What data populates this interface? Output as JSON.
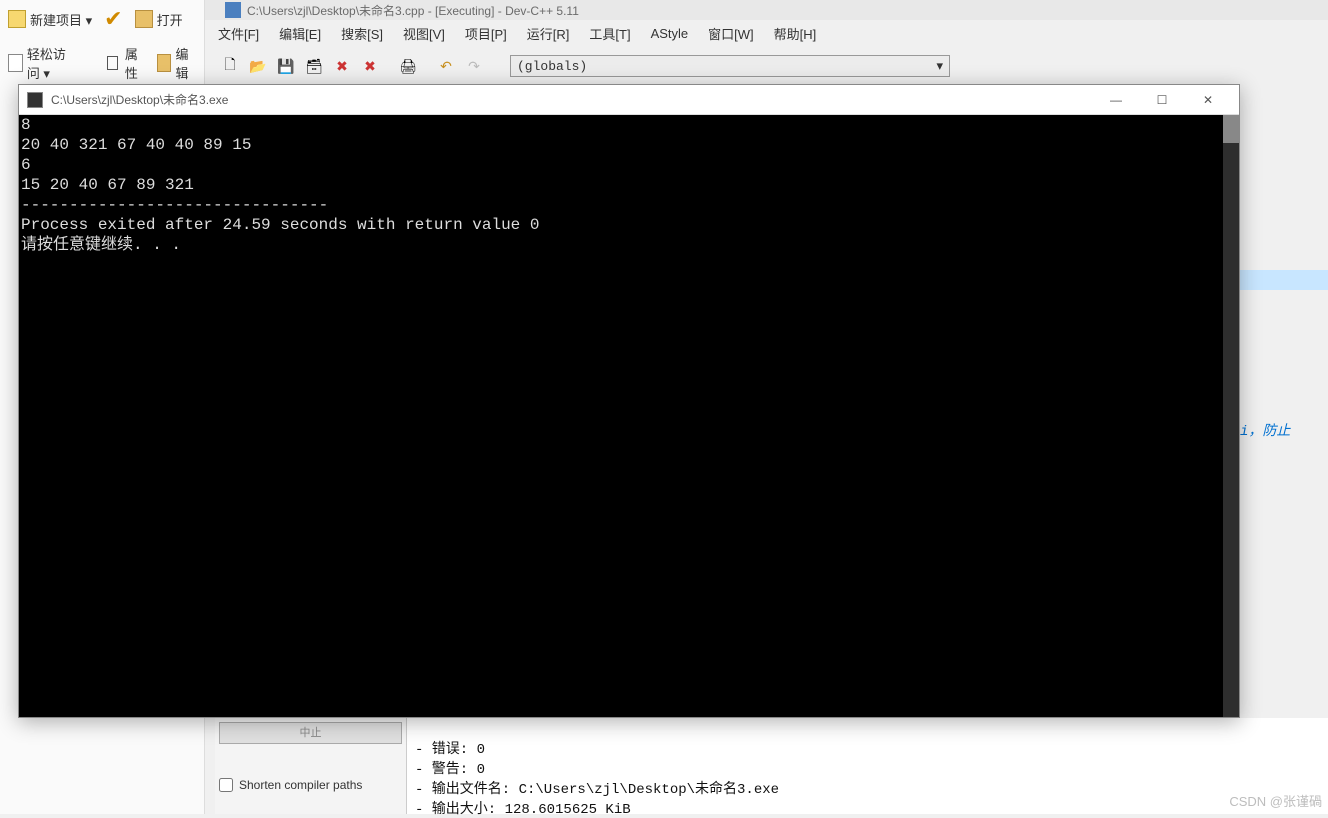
{
  "devcpp": {
    "title": "C:\\Users\\zjl\\Desktop\\未命名3.cpp - [Executing] - Dev-C++ 5.11",
    "ribbon": {
      "new_project": "新建项目 ▾",
      "easy_access": "轻松访问 ▾",
      "open": "打开",
      "edit": "编辑",
      "properties": "属性"
    },
    "menu": [
      "文件[F]",
      "编辑[E]",
      "搜索[S]",
      "视图[V]",
      "项目[P]",
      "运行[R]",
      "工具[T]",
      "AStyle",
      "窗口[W]",
      "帮助[H]"
    ],
    "globals": "(globals)"
  },
  "code": {
    "comment_fragment": "i，防止"
  },
  "console": {
    "title": "C:\\Users\\zjl\\Desktop\\未命名3.exe",
    "lines": [
      "8",
      "20 40 321 67 40 40 89 15",
      "6",
      "15 20 40 67 89 321",
      "--------------------------------",
      "Process exited after 24.59 seconds with return value 0",
      "请按任意键继续. . ."
    ]
  },
  "bottom": {
    "stop_label": "中止",
    "shorten_label": "Shorten compiler paths",
    "log_lines": [
      "",
      "- 错误: 0",
      "- 警告: 0",
      "- 输出文件名: C:\\Users\\zjl\\Desktop\\未命名3.exe",
      "- 输出大小: 128.6015625 KiB"
    ]
  },
  "watermark": "CSDN @张谨碢"
}
